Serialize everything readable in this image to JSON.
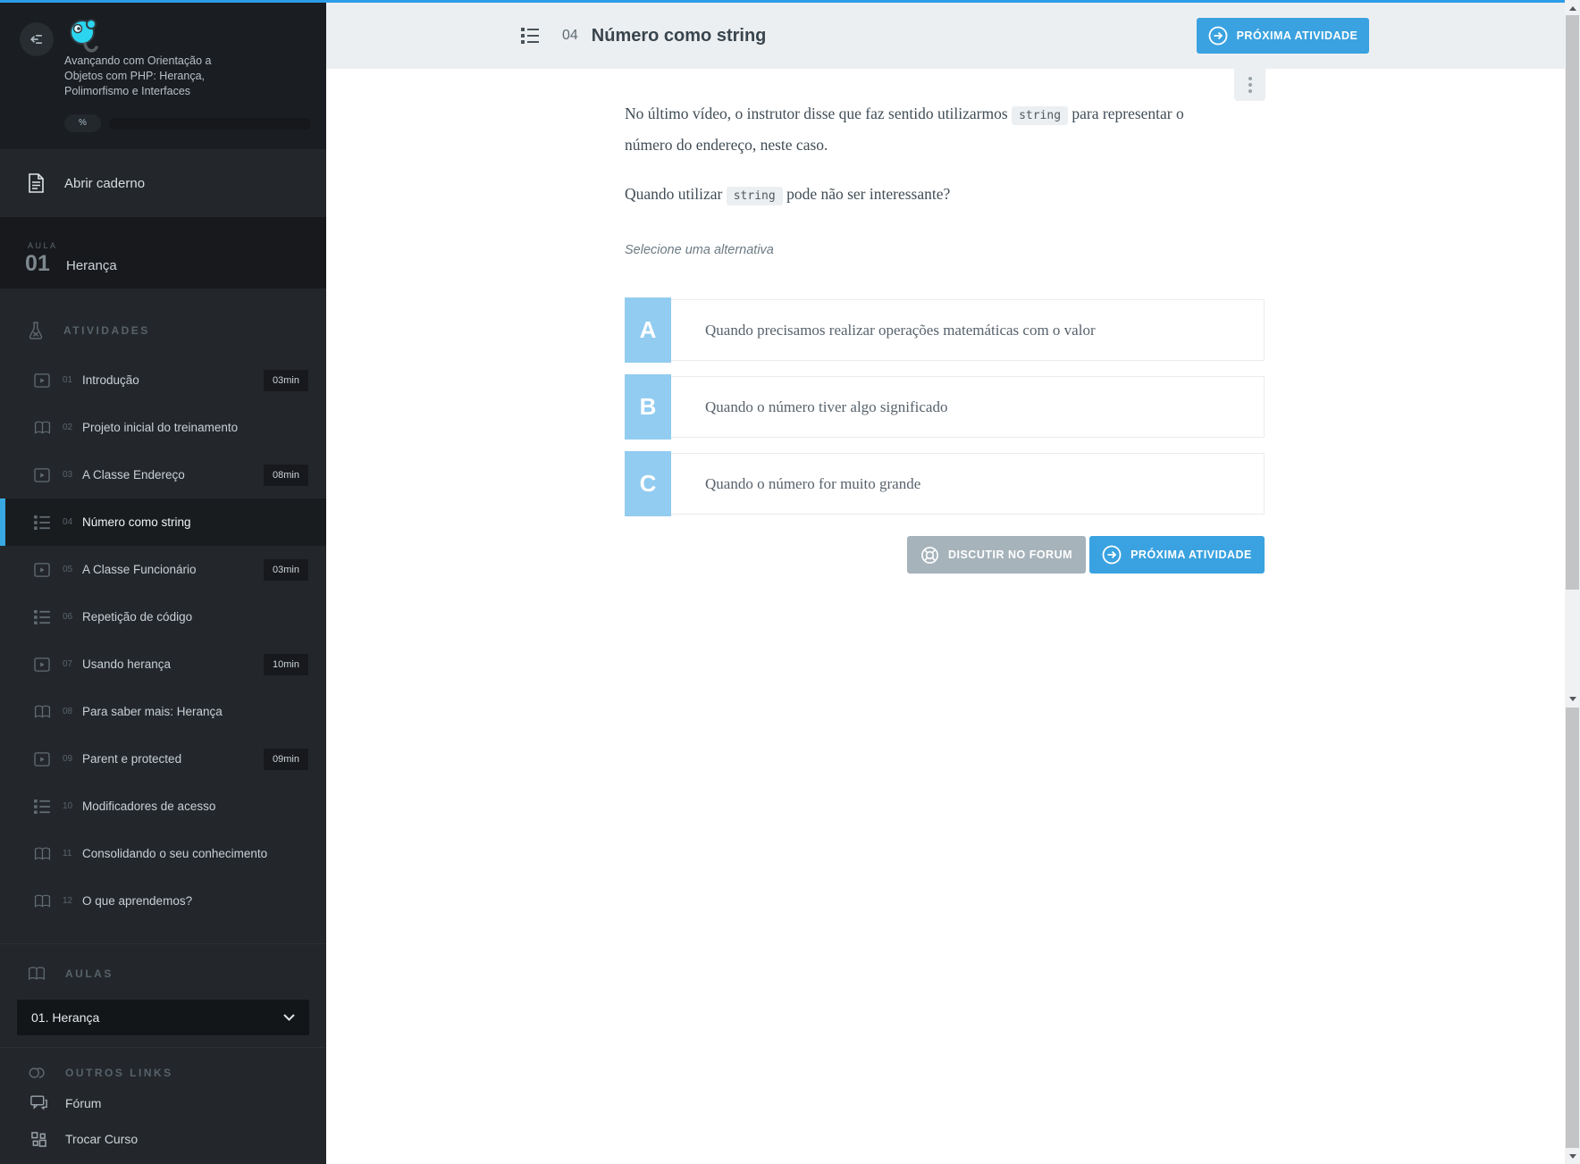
{
  "chrome": {
    "accent_line_color": "#2d9ce8"
  },
  "sidebar": {
    "course_title": "Avançando com Orientação a Objetos com PHP: Herança, Polimorfismo e Interfaces",
    "progress_label": "%",
    "notebook_label": "Abrir caderno",
    "lesson": {
      "kicker": "AULA",
      "number": "01",
      "title": "Herança"
    },
    "activities_header": "ATIVIDADES",
    "activities": [
      {
        "num": "01",
        "label": "Introdução",
        "icon": "video",
        "duration": "03min",
        "active": false
      },
      {
        "num": "02",
        "label": "Projeto inicial do treinamento",
        "icon": "book",
        "duration": "",
        "active": false
      },
      {
        "num": "03",
        "label": "A Classe Endereço",
        "icon": "video",
        "duration": "08min",
        "active": false
      },
      {
        "num": "04",
        "label": "Número como string",
        "icon": "list",
        "duration": "",
        "active": true
      },
      {
        "num": "05",
        "label": "A Classe Funcionário",
        "icon": "video",
        "duration": "03min",
        "active": false
      },
      {
        "num": "06",
        "label": "Repetição de código",
        "icon": "list",
        "duration": "",
        "active": false
      },
      {
        "num": "07",
        "label": "Usando herança",
        "icon": "video",
        "duration": "10min",
        "active": false
      },
      {
        "num": "08",
        "label": "Para saber mais: Herança",
        "icon": "book",
        "duration": "",
        "active": false
      },
      {
        "num": "09",
        "label": "Parent e protected",
        "icon": "video",
        "duration": "09min",
        "active": false
      },
      {
        "num": "10",
        "label": "Modificadores de acesso",
        "icon": "list",
        "duration": "",
        "active": false
      },
      {
        "num": "11",
        "label": "Consolidando o seu conhecimento",
        "icon": "book",
        "duration": "",
        "active": false
      },
      {
        "num": "12",
        "label": "O que aprendemos?",
        "icon": "book",
        "duration": "",
        "active": false
      }
    ],
    "aulas_header": "AULAS",
    "aula_select_value": "01. Herança",
    "links_header": "OUTROS LINKS",
    "links": [
      {
        "label": "Fórum",
        "icon": "chat"
      },
      {
        "label": "Trocar Curso",
        "icon": "grid"
      }
    ]
  },
  "header": {
    "activity_number": "04",
    "title": "Número como string",
    "next_button": "PRÓXIMA ATIVIDADE"
  },
  "question": {
    "p1_before": "No último vídeo, o instrutor disse que faz sentido utilizarmos",
    "p1_code": "string",
    "p1_after": "para representar o número do endereço, neste caso.",
    "p2_before": "Quando utilizar",
    "p2_code": "string",
    "p2_after": "pode não ser interessante?",
    "hint": "Selecione uma alternativa",
    "options": [
      {
        "letter": "A",
        "text": "Quando precisamos realizar operações matemáticas com o valor"
      },
      {
        "letter": "B",
        "text": "Quando o número tiver algo significado"
      },
      {
        "letter": "C",
        "text": "Quando o número for muito grande"
      }
    ]
  },
  "footer": {
    "forum_button": "DISCUTIR NO FORUM",
    "next_button": "PRÓXIMA ATIVIDADE"
  },
  "colors": {
    "accent_blue": "#3aa2e0",
    "option_letter_bg": "#92ccf0",
    "forum_button_bg": "#a6b3bb",
    "sidebar_bg": "#23272b",
    "header_band_bg": "#eceff1"
  }
}
